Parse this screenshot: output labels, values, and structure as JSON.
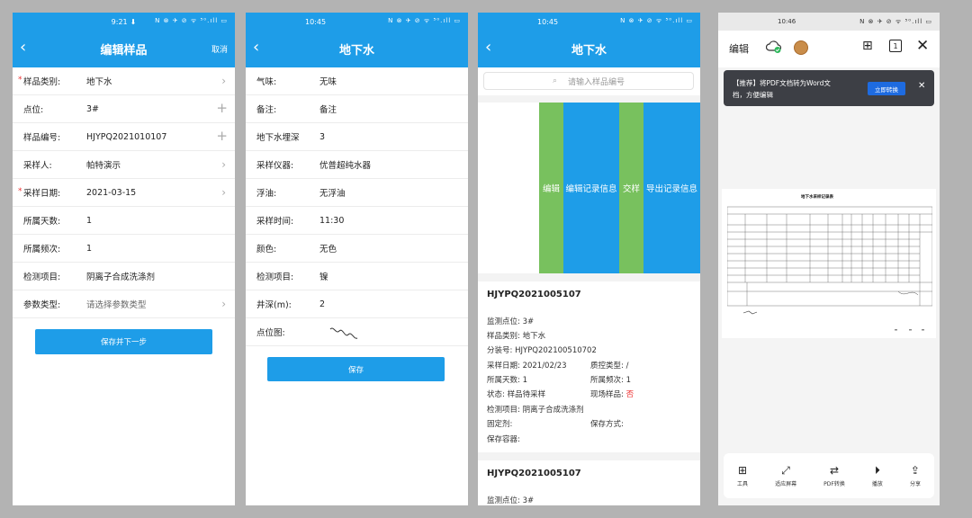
{
  "phone1": {
    "status_time": "9:21",
    "status_icons": "N ⊗ ✈ ⊘ ᯤ ⁵⁰.ıll ▭",
    "title": "编辑样品",
    "right_action": "取消",
    "rows": [
      {
        "label": "样品类别:",
        "value": "地下水",
        "required": true
      },
      {
        "label": "点位:",
        "value": "3#"
      },
      {
        "label": "样品编号:",
        "value": "HJYPQ2021010107"
      },
      {
        "label": "采样人:",
        "value": "帕特演示"
      },
      {
        "label": "采样日期:",
        "value": "2021-03-15",
        "required": true
      },
      {
        "label": "所属天数:",
        "value": "1"
      },
      {
        "label": "所属频次:",
        "value": "1"
      },
      {
        "label": "检测项目:",
        "value": "阴离子合成洗涤剂"
      },
      {
        "label": "参数类型:",
        "value": "请选择参数类型"
      }
    ],
    "save_button": "保存并下一步"
  },
  "phone2": {
    "status_time": "10:45",
    "status_icons": "N ⊗ ✈ ⊘ ᯤ ⁵⁰.ıll ▭",
    "title": "地下水",
    "rows": [
      {
        "label": "气味:",
        "value": "无味"
      },
      {
        "label": "备注:",
        "value": "备注"
      },
      {
        "label": "地下水埋深",
        "value": "3"
      },
      {
        "label": "采样仪器:",
        "value": "优普超纯水器"
      },
      {
        "label": "浮油:",
        "value": "无浮油"
      },
      {
        "label": "采样时间:",
        "value": "11:30"
      },
      {
        "label": "颜色:",
        "value": "无色"
      },
      {
        "label": "检测项目:",
        "value": "镍"
      },
      {
        "label": "井深(m):",
        "value": "2"
      },
      {
        "label": "点位图:",
        "value": ""
      }
    ],
    "save_button": "保存"
  },
  "phone3": {
    "status_time": "10:45",
    "status_icons": "N ⊗ ✈ ⊘ ᯤ ⁵⁰.ıll ▭",
    "title": "地下水",
    "search_placeholder": "请输入样品编号",
    "actions": [
      "编辑",
      "编辑记录信息",
      "交样",
      "导出记录信息"
    ],
    "card1": {
      "sample_no": "HJYPQ2021005107",
      "point": "监测点位:  3#",
      "category": "样品类别:  地下水",
      "split_no": "分装号:  HJYPQ202100510702",
      "date": "采样日期:  2021/02/23",
      "qc_type": "质控类型:  /",
      "days": "所属天数:  1",
      "freq": "所属频次:  1",
      "state": "状态:  样品待采样",
      "field_sample_label": "现场样品:",
      "field_sample_value": "否",
      "items": "检测项目:  阴离子合成洗涤剂",
      "fixative": "固定剂:",
      "storage": "保存方式:",
      "container": "保存容器:"
    },
    "card2": {
      "sample_no": "HJYPQ2021005107",
      "point": "监测点位:  3#"
    }
  },
  "phone4": {
    "status_time": "10:46",
    "status_icons": "N ⊗ ✈ ⊘ ᯤ ⁵⁰.ıll ▭",
    "edit_label": "编辑",
    "tab_count": "1",
    "banner_text_1": "【推荐】将PDF文档转为Word文",
    "banner_text_2": "档，方便编辑",
    "banner_button": "立即转换",
    "doc_title": "地下水采样记录表",
    "bottom_items": [
      "工具",
      "适应屏幕",
      "PDF转换",
      "播放",
      "分享"
    ]
  },
  "colors": {
    "primary": "#1e9de8",
    "swipe_green": "#78c15e",
    "banner_dark": "#3d3f45"
  }
}
